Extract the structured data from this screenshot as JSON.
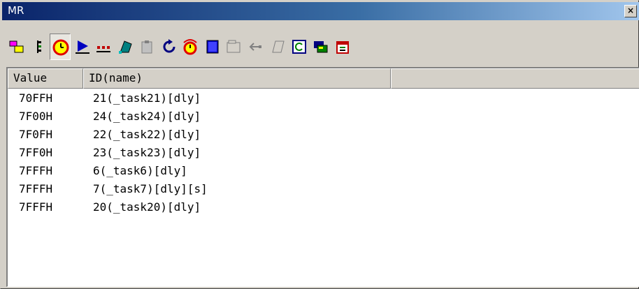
{
  "window": {
    "title": "MR",
    "close_glyph": "×"
  },
  "toolbar": {
    "buttons": [
      {
        "icon": "task-icon",
        "color": "#ff00ff"
      },
      {
        "icon": "tree-icon",
        "color": "#000000"
      },
      {
        "icon": "clock-icon",
        "color": "#e00000",
        "pressed": true
      },
      {
        "icon": "play-icon",
        "color": "#0000c0"
      },
      {
        "icon": "dots-icon",
        "color": "#c00000"
      },
      {
        "icon": "bucket-icon",
        "color": "#008080"
      },
      {
        "icon": "clipboard-icon",
        "color": "#808080"
      },
      {
        "icon": "rotate-icon",
        "color": "#000080"
      },
      {
        "icon": "alarm-icon",
        "color": "#e00000"
      },
      {
        "icon": "book-icon",
        "color": "#0000c0"
      },
      {
        "icon": "folder-icon",
        "color": "#808080"
      },
      {
        "icon": "arrow-icon",
        "color": "#808080"
      },
      {
        "icon": "page-icon",
        "color": "#808080"
      },
      {
        "icon": "refresh-icon",
        "color": "#008000"
      },
      {
        "icon": "flag-icon",
        "color": "#008000"
      },
      {
        "icon": "calendar-icon",
        "color": "#c00000"
      }
    ]
  },
  "table": {
    "columns": [
      "Value",
      "ID(name)"
    ],
    "rows": [
      {
        "value": "70FFH",
        "id": "21(_task21)[dly]"
      },
      {
        "value": "7F00H",
        "id": "24(_task24)[dly]"
      },
      {
        "value": "7F0FH",
        "id": "22(_task22)[dly]"
      },
      {
        "value": "7FF0H",
        "id": "23(_task23)[dly]"
      },
      {
        "value": "7FFFH",
        "id": "6(_task6)[dly]"
      },
      {
        "value": "7FFFH",
        "id": "7(_task7)[dly][s]"
      },
      {
        "value": "7FFFH",
        "id": "20(_task20)[dly]"
      }
    ]
  }
}
